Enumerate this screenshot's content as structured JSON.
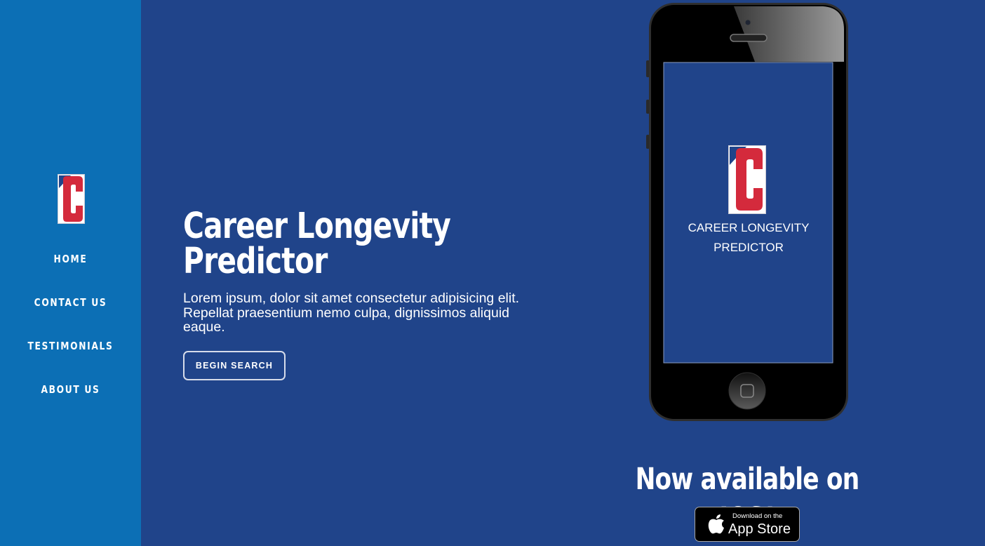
{
  "sidebar": {
    "logo_letter": "C",
    "nav": [
      {
        "label": "HOME"
      },
      {
        "label": "CONTACT US"
      },
      {
        "label": "TESTIMONIALS"
      },
      {
        "label": "ABOUT US"
      }
    ]
  },
  "hero": {
    "title_line1": "Career Longevity",
    "title_line2": "Predictor",
    "description": "Lorem ipsum, dolor sit amet consectetur adipisicing elit. Repellat praesentium nemo culpa, dignissimos aliquid eaque.",
    "cta_label": "BEGIN SEARCH"
  },
  "phone": {
    "screen_title_line1": "CAREER LONGEVITY",
    "screen_title_line2": "PREDICTOR"
  },
  "availability": {
    "heading": "Now available on IOS!",
    "badge_small": "Download on the",
    "badge_big": "App Store"
  },
  "colors": {
    "page_bg": "#20448a",
    "sidebar_bg": "#0c6fb5",
    "logo_red": "#d42a3c",
    "logo_blue": "#20448a",
    "text": "#ffffff"
  }
}
